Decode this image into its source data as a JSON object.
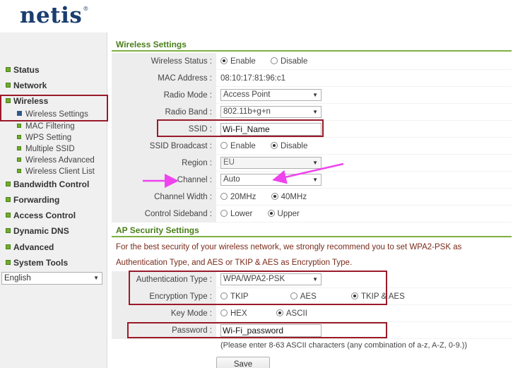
{
  "brand": {
    "name": "netis",
    "mark": "®"
  },
  "sidebar": {
    "items": [
      {
        "label": "Status"
      },
      {
        "label": "Network"
      },
      {
        "label": "Wireless"
      },
      {
        "label": "Bandwidth Control"
      },
      {
        "label": "Forwarding"
      },
      {
        "label": "Access Control"
      },
      {
        "label": "Dynamic DNS"
      },
      {
        "label": "Advanced"
      },
      {
        "label": "System Tools"
      }
    ],
    "wireless_sub": [
      {
        "label": "Wireless Settings"
      },
      {
        "label": "MAC Filtering"
      },
      {
        "label": "WPS Setting"
      },
      {
        "label": "Multiple SSID"
      },
      {
        "label": "Wireless Advanced"
      },
      {
        "label": "Wireless Client List"
      }
    ],
    "language": "English"
  },
  "wireless": {
    "title": "Wireless Settings",
    "status_label": "Wireless Status :",
    "enable": "Enable",
    "disable": "Disable",
    "mac_label": "MAC Address :",
    "mac_value": "08:10:17:81:96:c1",
    "mode_label": "Radio Mode :",
    "mode_value": "Access Point",
    "band_label": "Radio Band :",
    "band_value": "802.11b+g+n",
    "ssid_label": "SSID :",
    "ssid_value": "Wi-Fi_Name",
    "broadcast_label": "SSID Broadcast :",
    "region_label": "Region :",
    "region_value": "EU",
    "channel_label": "Channel :",
    "channel_value": "Auto",
    "width_label": "Channel Width :",
    "width_20": "20MHz",
    "width_40": "40MHz",
    "sideband_label": "Control Sideband :",
    "lower": "Lower",
    "upper": "Upper"
  },
  "security": {
    "title": "AP Security Settings",
    "note_line1": "For the best security of your wireless network, we strongly recommend you to set WPA2-PSK as",
    "note_line2": "Authentication Type, and AES or TKIP & AES as Encryption Type.",
    "auth_label": "Authentication Type :",
    "auth_value": "WPA/WPA2-PSK",
    "enc_label": "Encryption Type :",
    "tkip": "TKIP",
    "aes": "AES",
    "tkip_aes": "TKIP & AES",
    "keymode_label": "Key Mode :",
    "hex": "HEX",
    "ascii": "ASCII",
    "password_label": "Password :",
    "password_value": "Wi-Fi_password",
    "hint": "(Please enter 8-63 ASCII characters (any combination of a-z, A-Z, 0-9.))",
    "save": "Save"
  },
  "colors": {
    "accent": "#7fb041",
    "highlight": "#9a1a2a",
    "annotation": "#ee44ee",
    "brand": "#1b3d6e"
  }
}
